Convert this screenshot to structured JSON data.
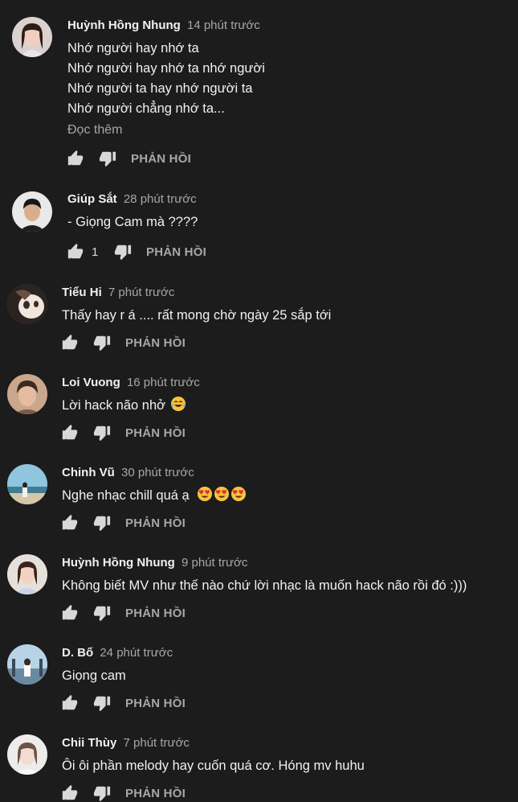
{
  "comments": [
    {
      "author": "Huỳnh Hồng Nhung",
      "time": "14 phút trước",
      "lines": [
        "Nhớ người hay nhớ ta",
        "Nhớ người hay nhớ ta nhớ người",
        "Nhớ người ta hay nhớ người ta",
        "Nhớ người chẳng nhớ ta..."
      ],
      "read_more": "Đọc thêm",
      "likes": "",
      "reply_label": "PHẢN HỒI"
    },
    {
      "author": "Giúp Sắt",
      "time": "28 phút trước",
      "lines": [
        "- Giọng Cam mà ????"
      ],
      "likes": "1",
      "reply_label": "PHẢN HỒI"
    },
    {
      "author": "Tiểu Hi",
      "time": "7 phút trước",
      "lines": [
        "Thấy hay r á .... rất mong chờ ngày 25 sắp tới"
      ],
      "likes": "",
      "reply_label": "PHẢN HỒI"
    },
    {
      "author": "Loi Vuong",
      "time": "16 phút trước",
      "lines": [
        "Lời hack não nhở"
      ],
      "emoji": [
        "tears-of-joy"
      ],
      "likes": "",
      "reply_label": "PHẢN HỒI"
    },
    {
      "author": "Chinh Vũ",
      "time": "30 phút trước",
      "lines": [
        "Nghe nhạc chill quá ạ"
      ],
      "emoji": [
        "heart-eyes",
        "heart-eyes",
        "heart-eyes"
      ],
      "likes": "",
      "reply_label": "PHẢN HỒI"
    },
    {
      "author": "Huỳnh Hồng Nhung",
      "time": "9 phút trước",
      "lines": [
        "Không biết MV như thế nào chứ lời nhạc là muốn hack não rồi đó :)))"
      ],
      "likes": "",
      "reply_label": "PHẢN HỒI"
    },
    {
      "author": "D. Bố",
      "time": "24 phút trước",
      "lines": [
        "Giọng cam"
      ],
      "likes": "",
      "reply_label": "PHẢN HỒI"
    },
    {
      "author": "Chii Thùy",
      "time": "7 phút trước",
      "lines": [
        "Ôi ôi phần melody hay cuốn quá cơ. Hóng mv huhu"
      ],
      "likes": "",
      "reply_label": "PHẢN HỒI"
    }
  ],
  "icons": {
    "like": "thumb-up-icon",
    "dislike": "thumb-down-icon"
  },
  "colors": {
    "background": "#1c1c1c",
    "text": "#f1f1f1",
    "muted": "#a7a7a7"
  }
}
